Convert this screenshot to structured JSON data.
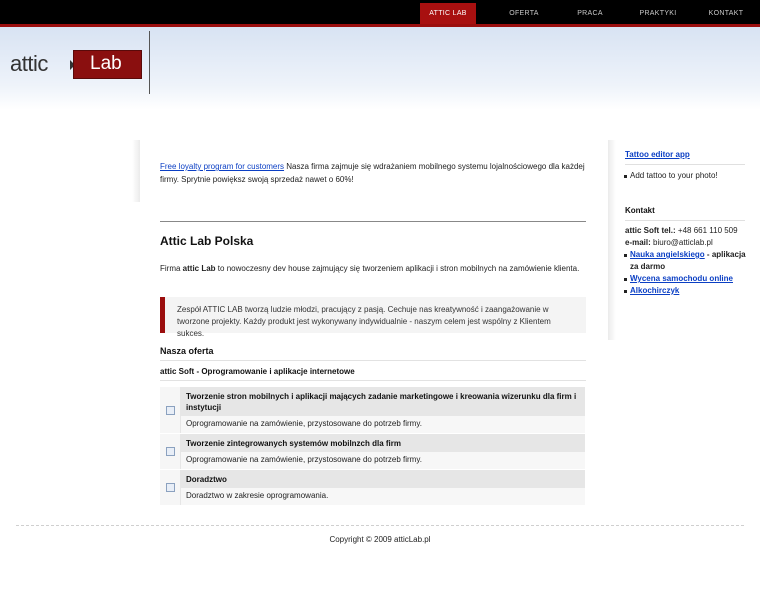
{
  "nav": {
    "items": [
      {
        "label": "ATTIC LAB",
        "active": true
      },
      {
        "label": "OFERTA",
        "active": false
      },
      {
        "label": "PRACA",
        "active": false
      },
      {
        "label": "PRAKTYKI",
        "active": false
      },
      {
        "label": "KONTAKT",
        "active": false
      }
    ]
  },
  "logo": {
    "word1": "attic",
    "word2": "Lab"
  },
  "promo": {
    "link": "Free loyalty program for customers",
    "text": " Nasza firma zajmuje się wdrażaniem mobilnego systemu lojalnościowego dla każdej firmy. Sprytnie powiększ swoją sprzedaż nawet o 60%!"
  },
  "main": {
    "title": "Attic Lab Polska",
    "intro_prefix": "Firma ",
    "intro_bold": "attic Lab",
    "intro_suffix": " to nowoczesny dev house zajmujący się tworzeniem aplikacji i stron mobilnych na zamówienie klienta.",
    "quote": "Zespół ATTIC LAB tworzą ludzie młodzi, pracujący z pasją. Cechuje nas kreatywność i zaangażowanie w tworzone projekty. Każdy produkt jest wykonywany indywidualnie - naszym celem jest wspólny z Klientem sukces.",
    "section_title": "Nasza oferta",
    "sub_title": "attic Soft - Oprogramowanie i aplikacje internetowe",
    "offers": [
      {
        "head": "Tworzenie stron mobilnych i aplikacji mających zadanie marketingowe i kreowania wizerunku dla firm i instytucji",
        "desc": "Oprogramowanie na zamówienie, przystosowane do potrzeb firmy."
      },
      {
        "head": "Tworzenie zintegrowanych systemów mobilnzch dla firm",
        "desc": "Oprogramowanie na zamówienie, przystosowane do potrzeb firmy."
      },
      {
        "head": "Doradztwo",
        "desc": "Doradztwo w zakresie oprogramowania."
      }
    ]
  },
  "sidebar": {
    "tattoo_title": "Tattoo editor app",
    "tattoo_item": "Add tattoo to your photo!",
    "kontakt_title": "Kontakt",
    "phone_label": "attic Soft tel.:",
    "phone_value": " +48 661 110 509",
    "email_label": "e-mail:",
    "email_value": " biuro@atticlab.pl",
    "links": [
      {
        "link": "Nauka angielskiego",
        "suffix": " - aplikacja za darmo"
      },
      {
        "link": "Wycena samochodu online",
        "suffix": ""
      },
      {
        "link": "Alkochirczyk",
        "suffix": ""
      }
    ]
  },
  "footer": {
    "copyright": "Copyright © 2009 atticLab.pl"
  }
}
